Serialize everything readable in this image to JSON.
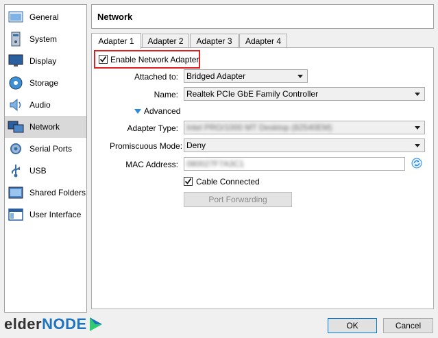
{
  "sidebar": {
    "items": [
      {
        "label": "General",
        "icon": "general-icon"
      },
      {
        "label": "System",
        "icon": "system-icon"
      },
      {
        "label": "Display",
        "icon": "display-icon"
      },
      {
        "label": "Storage",
        "icon": "storage-icon"
      },
      {
        "label": "Audio",
        "icon": "audio-icon"
      },
      {
        "label": "Network",
        "icon": "network-icon",
        "active": true
      },
      {
        "label": "Serial Ports",
        "icon": "serial-ports-icon"
      },
      {
        "label": "USB",
        "icon": "usb-icon"
      },
      {
        "label": "Shared Folders",
        "icon": "shared-folders-icon"
      },
      {
        "label": "User Interface",
        "icon": "user-interface-icon"
      }
    ]
  },
  "header": {
    "title": "Network"
  },
  "tabs": [
    {
      "label": "Adapter 1",
      "active": true
    },
    {
      "label": "Adapter 2"
    },
    {
      "label": "Adapter 3"
    },
    {
      "label": "Adapter 4"
    }
  ],
  "form": {
    "enable_label": "Enable Network Adapter",
    "enable_checked": true,
    "attached_label": "Attached to:",
    "attached_value": "Bridged Adapter",
    "name_label": "Name:",
    "name_value": "Realtek PCIe GbE Family Controller",
    "advanced_label": "Advanced",
    "adapter_type_label": "Adapter Type:",
    "adapter_type_value": "Intel PRO/1000 MT Desktop (82540EM)",
    "promiscuous_label": "Promiscuous Mode:",
    "promiscuous_value": "Deny",
    "mac_label": "MAC Address:",
    "mac_value": "080027F7A3C1",
    "cable_label": "Cable Connected",
    "cable_checked": true,
    "port_forwarding_label": "Port Forwarding"
  },
  "footer": {
    "ok_label": "OK",
    "cancel_label": "Cancel",
    "logo_text_dark": "elder",
    "logo_text_accent": "node"
  },
  "colors": {
    "accent_blue": "#1e73be",
    "highlight_red": "#e02020",
    "logo_green": "#2ecc71"
  }
}
